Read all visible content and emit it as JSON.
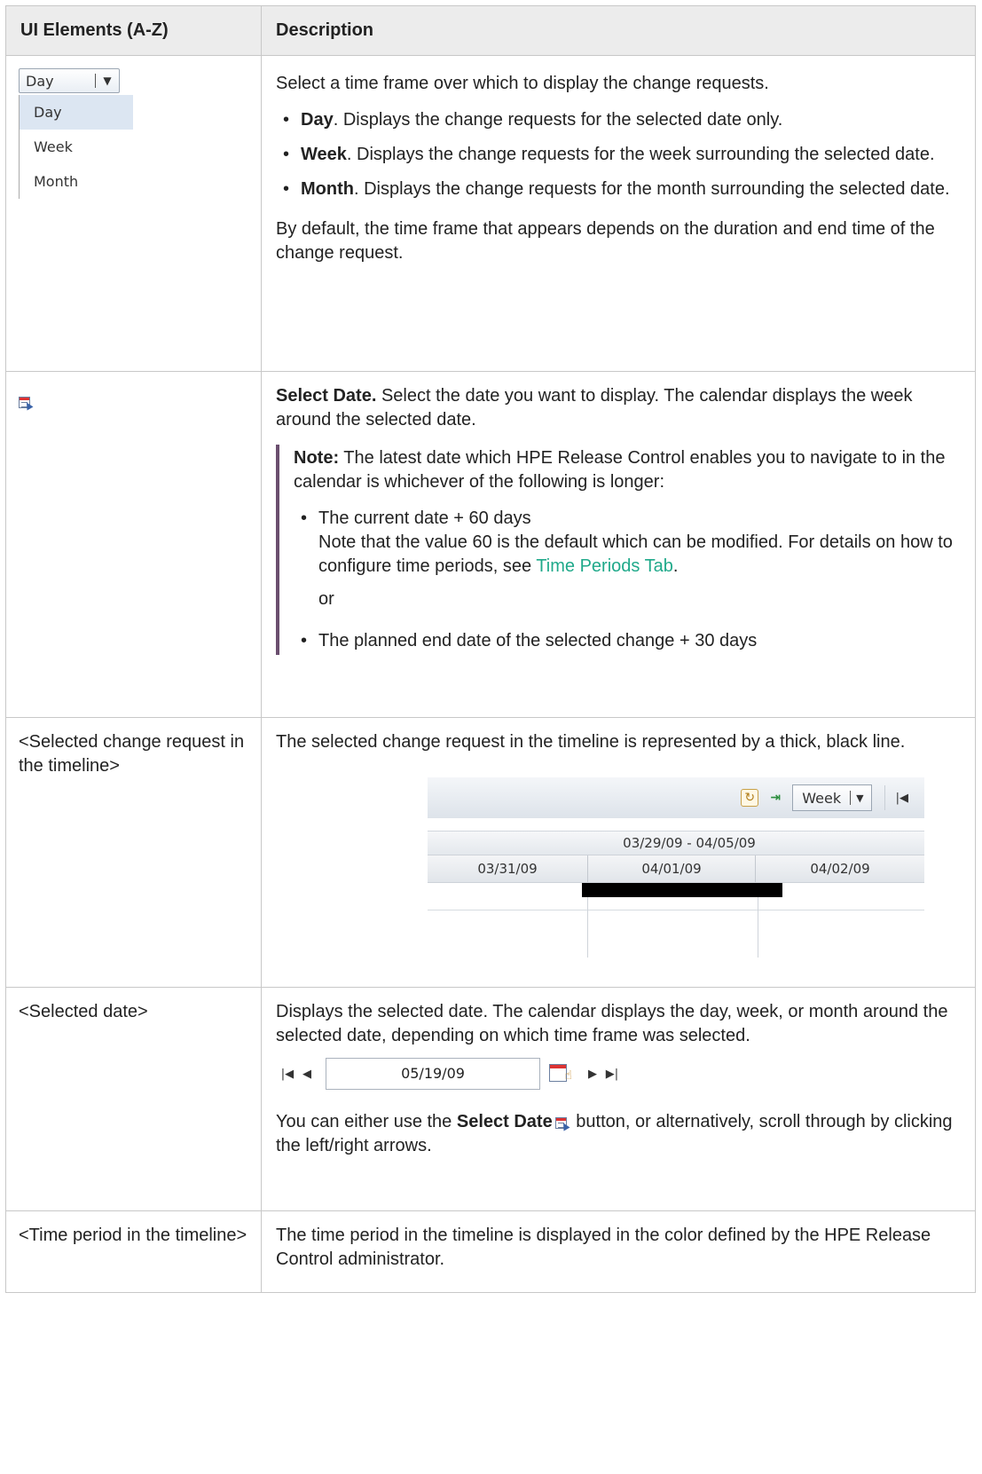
{
  "table": {
    "headers": {
      "elements": "UI Elements (A-Z)",
      "description": "Description"
    },
    "rows": {
      "timeframe": {
        "dropdown": {
          "selected": "Day",
          "options": [
            "Day",
            "Week",
            "Month"
          ]
        },
        "intro": "Select a time frame over which to display the change requests.",
        "items": [
          {
            "term": "Day",
            "text": ". Displays the change requests for the selected date only."
          },
          {
            "term": "Week",
            "text": ". Displays the change requests for the week surrounding the selected date."
          },
          {
            "term": "Month",
            "text": ". Displays the change requests for the month surrounding the selected date."
          }
        ],
        "outro": "By default, the time frame that appears depends on the duration and end time of the change request."
      },
      "select_date": {
        "icon": "calendar-select-icon",
        "title": "Select Date.",
        "text": " Select the date you want to display. The calendar displays the week around the selected date.",
        "note_label": "Note:",
        "note_text": " The latest date which HPE Release Control enables you to navigate to in the calendar is whichever of the following is longer:",
        "bullet1_line1": "The current date + 60 days",
        "bullet1_line2": "Note that the value 60 is the default which can be modified. For details on how to configure time periods, see ",
        "bullet1_link": "Time Periods Tab",
        "bullet1_end": ".",
        "or": "or",
        "bullet2": "The planned end date of the selected change + 30 days"
      },
      "selected_change": {
        "element": "<Selected change request in the timeline>",
        "text": "The selected change request in the timeline is represented by a thick, black line.",
        "timeline": {
          "period_select": "Week",
          "range": "03/29/09 - 04/05/09",
          "days": [
            "03/31/09",
            "04/01/09",
            "04/02/09"
          ]
        }
      },
      "selected_date": {
        "element": "<Selected date>",
        "text": "Displays the selected date. The calendar displays the day, week, or month around the selected date, depending on which time frame was selected.",
        "date_value": "05/19/09",
        "text2_a": "You can either use the ",
        "text2_bold": "Select Date",
        "text2_b": " button, or alternatively, scroll through by clicking the left/right arrows."
      },
      "time_period": {
        "element": "<Time period in the timeline>",
        "text": "The time period in the timeline is displayed in the color defined by the HPE Release Control administrator."
      }
    }
  }
}
